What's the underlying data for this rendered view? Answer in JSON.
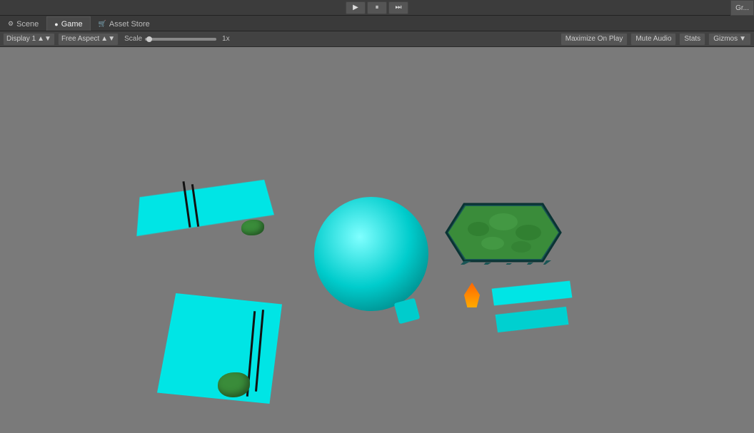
{
  "toolbar": {
    "play_label": "▶",
    "pause_label": "⏸",
    "step_label": "⏭",
    "top_right_label": "Gr..."
  },
  "tabs": [
    {
      "id": "scene",
      "label": "Scene",
      "icon": "⚙",
      "active": false
    },
    {
      "id": "game",
      "label": "Game",
      "icon": "●",
      "active": true
    },
    {
      "id": "asset-store",
      "label": "Asset Store",
      "icon": "🛒",
      "active": false
    }
  ],
  "secondary_toolbar": {
    "display_label": "Display 1",
    "aspect_label": "Free Aspect",
    "aspect_text": "Aspect",
    "scale_label": "Scale",
    "scale_value": "1x",
    "maximize_label": "Maximize On Play",
    "mute_label": "Mute Audio",
    "stats_label": "Stats",
    "gizmos_label": "Gizmos"
  },
  "viewport": {
    "background_color": "#7a7a7a"
  }
}
